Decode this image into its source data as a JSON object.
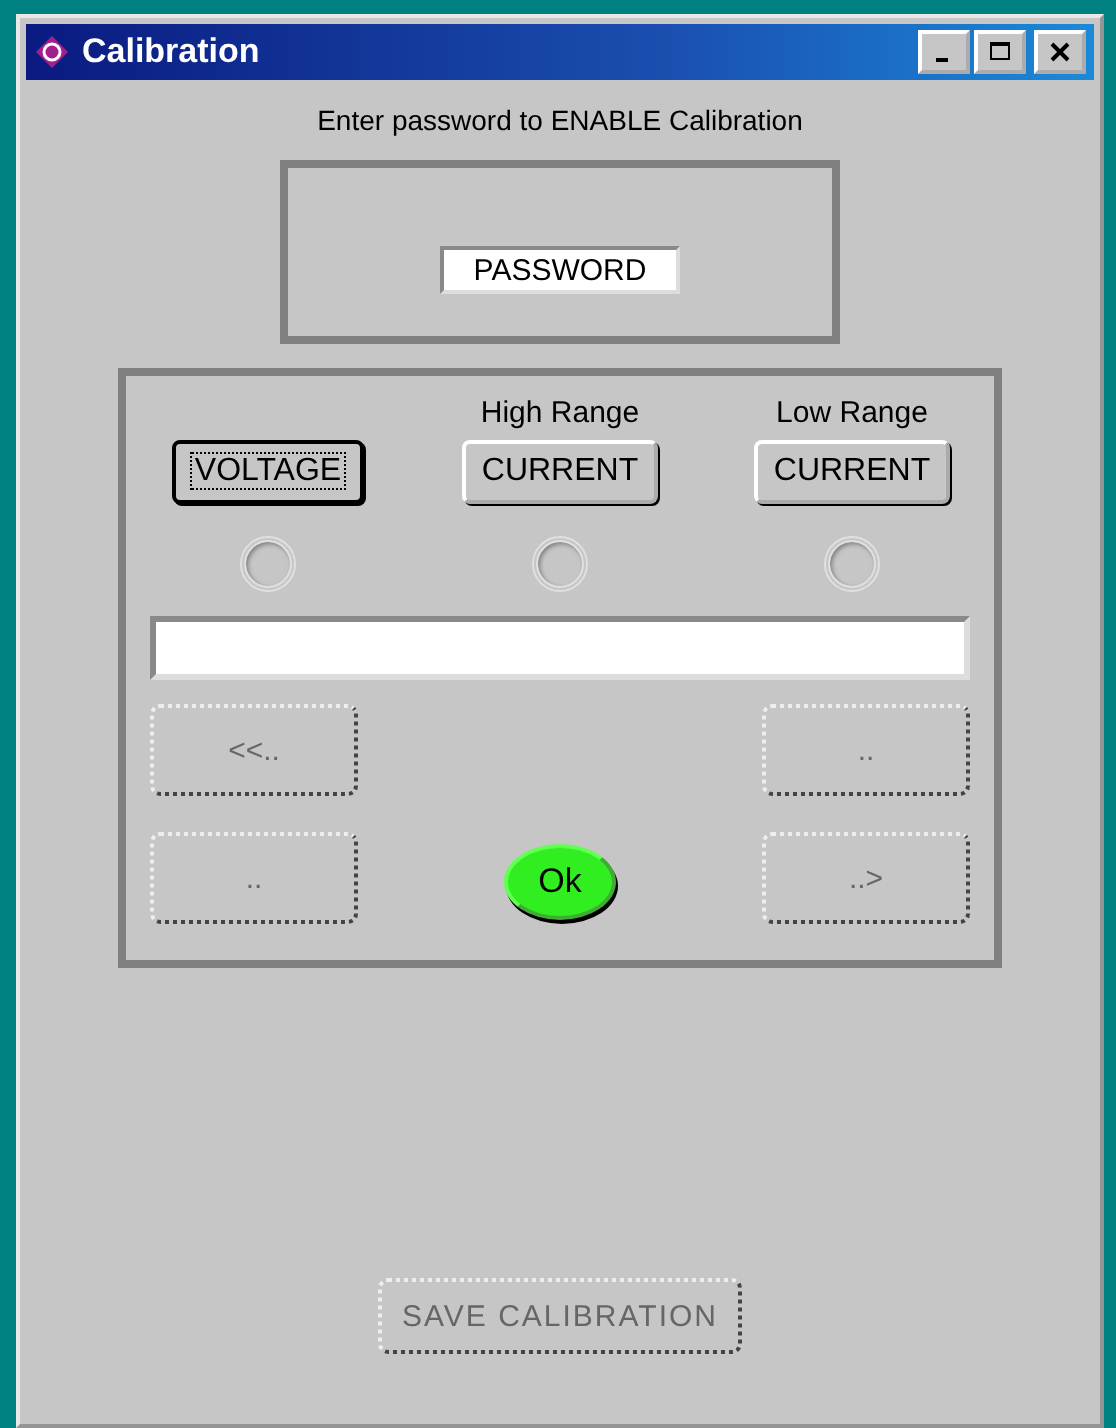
{
  "window": {
    "title": "Calibration"
  },
  "prompt": "Enter password to  ENABLE Calibration",
  "password": {
    "value": "PASSWORD"
  },
  "modes": [
    {
      "label": "VOLTAGE",
      "focused": true,
      "led_on": false
    },
    {
      "caption": "High Range",
      "label": "CURRENT",
      "focused": false,
      "led_on": false
    },
    {
      "caption": "Low Range",
      "label": "CURRENT",
      "focused": false,
      "led_on": false
    }
  ],
  "nav_buttons": [
    {
      "label": "<<..",
      "disabled": true
    },
    {
      "label": "..",
      "disabled": true
    },
    {
      "label": "..",
      "disabled": true
    },
    {
      "label": "..>",
      "disabled": true
    }
  ],
  "ok_button": {
    "label": "Ok"
  },
  "save_button": {
    "label": "SAVE CALIBRATION",
    "disabled": true
  }
}
